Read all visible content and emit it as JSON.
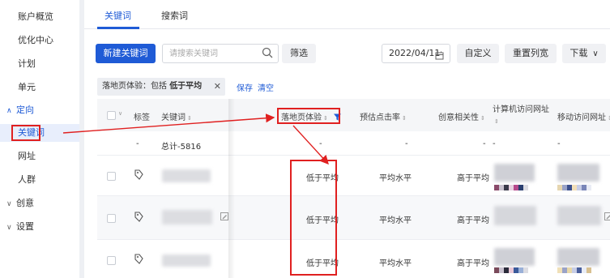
{
  "sidebar": {
    "items": [
      {
        "label": "账户概览"
      },
      {
        "label": "优化中心"
      },
      {
        "label": "计划"
      },
      {
        "label": "单元"
      },
      {
        "label": "定向",
        "group": true,
        "expanded": true
      },
      {
        "label": "关键词",
        "active": true
      },
      {
        "label": "网址"
      },
      {
        "label": "人群"
      },
      {
        "label": "创意",
        "group": true,
        "expanded": false
      },
      {
        "label": "设置",
        "group": true,
        "expanded": false
      }
    ]
  },
  "tabs": [
    {
      "label": "关键词",
      "active": true
    },
    {
      "label": "搜索词",
      "active": false
    }
  ],
  "toolbar": {
    "new_keyword_label": "新建关键词",
    "search_placeholder": "请搜索关键词",
    "filter_label": "筛选",
    "date_value": "2022/04/11",
    "custom_label": "自定义",
    "reset_columns_label": "重置列宽",
    "download_label": "下载"
  },
  "filter": {
    "tag_prefix": "落地页体验：包括",
    "tag_value": "低于平均",
    "save_label": "保存",
    "clear_label": "清空"
  },
  "table": {
    "headers": {
      "tag": "标签",
      "keyword": "关键词",
      "landing_page": "落地页体验",
      "est_ctr": "预估点击率",
      "ad_relevance": "创意相关性",
      "pc_url": "计算机访问网址",
      "mobile_url": "移动访问网址"
    },
    "total_row": {
      "dash": "-",
      "keyword": "总计-5816",
      "landing_page": "-",
      "est_ctr": "-",
      "ad_relevance": "-",
      "pc_url": "-",
      "mobile_url": "-"
    },
    "rows": [
      {
        "landing_page": "低于平均",
        "est_ctr": "平均水平",
        "ad_relevance": "高于平均"
      },
      {
        "landing_page": "低于平均",
        "est_ctr": "平均水平",
        "ad_relevance": "高于平均"
      },
      {
        "landing_page": "低于平均",
        "est_ctr": "平均水平",
        "ad_relevance": "高于平均"
      }
    ]
  },
  "colors": {
    "accent": "#1f5bd6",
    "annotation": "#e02020"
  }
}
